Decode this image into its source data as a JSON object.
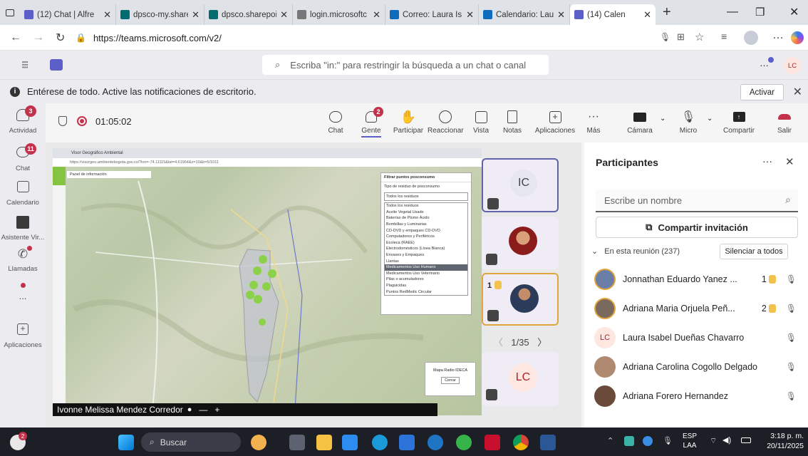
{
  "browser": {
    "tabs": [
      {
        "label": "(12) Chat | Alfre",
        "color": "#5b5fc7"
      },
      {
        "label": "dpsco-my.share",
        "color": "#036c70"
      },
      {
        "label": "dpsco.sharepoi",
        "color": "#036c70"
      },
      {
        "label": "login.microsoftc",
        "color": "#777"
      },
      {
        "label": "Correo: Laura Is",
        "color": "#0f6cbd"
      },
      {
        "label": "Calendario: Lau",
        "color": "#0f6cbd"
      },
      {
        "label": "(14) Calen",
        "color": "#5b5fc7"
      }
    ],
    "new_tab": "+",
    "url": "https://teams.microsoft.com/v2/"
  },
  "teams": {
    "search_placeholder": "Escriba \"in:\" para restringir la búsqueda a un chat o canal",
    "user_initials": "LC",
    "notification": "Entérese de todo. Active las notificaciones de escritorio.",
    "activate_label": "Activar"
  },
  "rail": [
    {
      "label": "Actividad",
      "badge": "3"
    },
    {
      "label": "Chat",
      "badge": "11"
    },
    {
      "label": "Calendario",
      "badge": ""
    },
    {
      "label": "Asistente Vir...",
      "badge": ""
    },
    {
      "label": "Llamadas",
      "badge": ""
    },
    {
      "label": "...",
      "badge": ""
    },
    {
      "label": "Aplicaciones",
      "badge": ""
    }
  ],
  "meeting": {
    "timer": "01:05:02",
    "controls": {
      "chat": "Chat",
      "people": "Gente",
      "people_badge": "2",
      "raise": "Participar",
      "react": "Reaccionar",
      "view": "Vista",
      "notes": "Notas",
      "apps": "Aplicaciones",
      "more": "Más",
      "camera": "Cámara",
      "mic": "Micro",
      "share": "Compartir",
      "leave": "Salir"
    }
  },
  "shared_screen": {
    "browser_tab": "Visor Geográfico Ambiental",
    "browser_url": "https://visorgeo.ambientebogota.gov.co/?lon=-74.11115&lat=4.61964&z=10&b=5/1011",
    "info_panel": "Panel de información",
    "filter_title": "Filtrar puntos posconsumo",
    "filter_label": "Tipo de residuo de posconsumo",
    "filter_selected": "Todos los residuos",
    "filter_options": [
      "Todos los residuos",
      "Aceite Vegetal Usado",
      "Baterías de Plomo Ácido",
      "Bombillas y Luminarias",
      "CD-DVD y empaques CD-DVD",
      "Computadores y Periféricos",
      "Ecoleca (RAEE)",
      "Electrodomésticos (Línea Blanca)",
      "Envases y Empaques",
      "Llantas",
      "Medicamentos Uso Humano",
      "Medicamentos Uso Veterinario",
      "Pilas o acumuladores",
      "Plaguicidas",
      "Puntos RedMedic Circular"
    ],
    "highlighted_option": "Medicamentos Uso Humano",
    "popup_title": "Mapa Radio IDECA",
    "popup_button": "Cerrar",
    "presenter": "Ivonne Melissa Mendez Corredor"
  },
  "tiles": {
    "initials_1": "IC",
    "raised_1": "1",
    "pager": "1/35",
    "initials_2": "LC"
  },
  "participants": {
    "title": "Participantes",
    "search_placeholder": "Escribe un nombre",
    "invite": "Compartir invitación",
    "section": "En esta reunión (237)",
    "mute_all": "Silenciar a todos",
    "people": [
      {
        "name": "Jonnathan Eduardo Yanez ...",
        "hand": "1",
        "initials": "",
        "color": "#6b7ea8"
      },
      {
        "name": "Adriana Maria Orjuela Peñ...",
        "hand": "2",
        "initials": "",
        "color": "#7a6a5e"
      },
      {
        "name": "Laura Isabel Dueñas Chavarro",
        "hand": "",
        "initials": "LC",
        "color": "#fde7e0"
      },
      {
        "name": "Adriana Carolina Cogollo Delgado",
        "hand": "",
        "initials": "",
        "color": "#b08a70"
      },
      {
        "name": "Adriana Forero Hernandez",
        "hand": "",
        "initials": "",
        "color": "#6a4a3a"
      }
    ]
  },
  "taskbar": {
    "search": "Buscar",
    "weather_badge": "2",
    "lang": "ESP",
    "lang2": "LAA",
    "time": "3:18 p. m.",
    "date": "20/11/2025"
  }
}
